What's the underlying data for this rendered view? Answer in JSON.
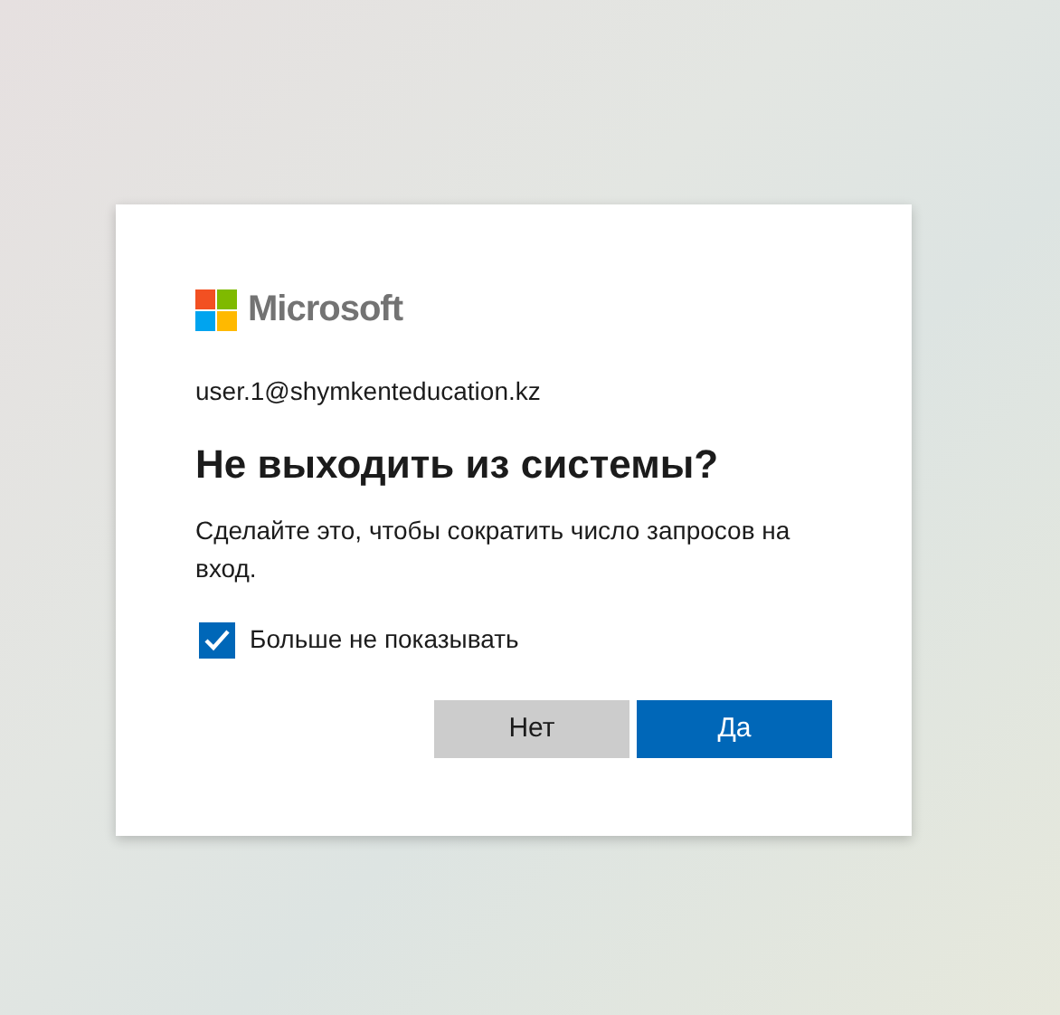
{
  "logo": {
    "text": "Microsoft"
  },
  "account": "user.1@shymkenteducation.kz",
  "title": "Не выходить из системы?",
  "description": "Сделайте это, чтобы сократить число запросов на вход.",
  "checkbox": {
    "label": "Больше не показывать",
    "checked": true
  },
  "buttons": [
    {
      "label": "Нет",
      "kind": "secondary"
    },
    {
      "label": "Да",
      "kind": "primary"
    }
  ]
}
